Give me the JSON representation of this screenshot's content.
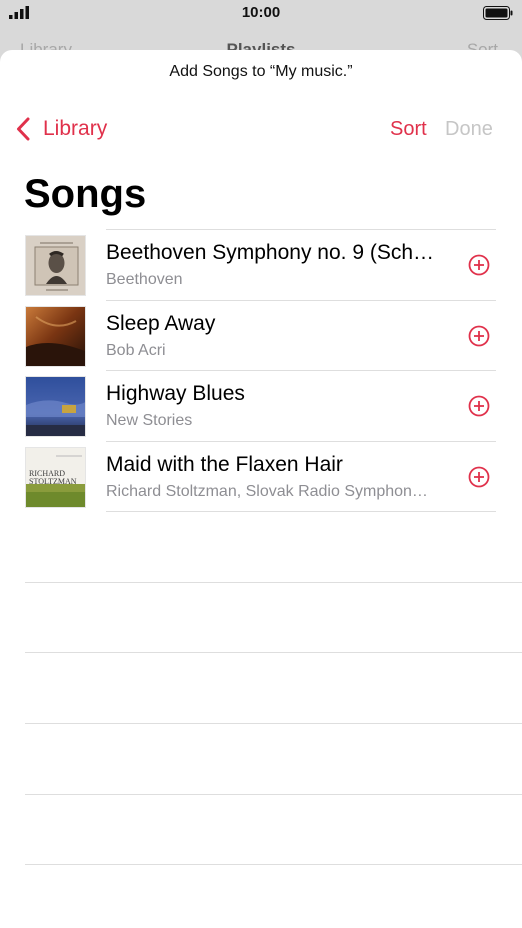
{
  "status_bar": {
    "time": "10:00",
    "signal_icon": "cellular-signal-icon",
    "battery_icon": "battery-full-icon"
  },
  "background_nav": {
    "back_label": "Library",
    "title": "Playlists",
    "sort_label": "Sort"
  },
  "sheet": {
    "prompt": "Add Songs to “My music.”",
    "back_label": "Library",
    "sort_label": "Sort",
    "done_label": "Done",
    "title": "Songs"
  },
  "songs": [
    {
      "title": "Beethoven Symphony no. 9 (Sch…",
      "artist": "Beethoven"
    },
    {
      "title": "Sleep Away",
      "artist": "Bob Acri"
    },
    {
      "title": "Highway Blues",
      "artist": "New Stories"
    },
    {
      "title": "Maid with the Flaxen Hair",
      "artist": "Richard Stoltzman, Slovak Radio Symphon…"
    }
  ],
  "album_art": {
    "richard_line1": "RICHARD",
    "richard_line2": "STOLTZMAN"
  },
  "colors": {
    "accent": "#e0314b",
    "disabled": "#c6c6c6",
    "secondary_text": "#8e8e93"
  }
}
